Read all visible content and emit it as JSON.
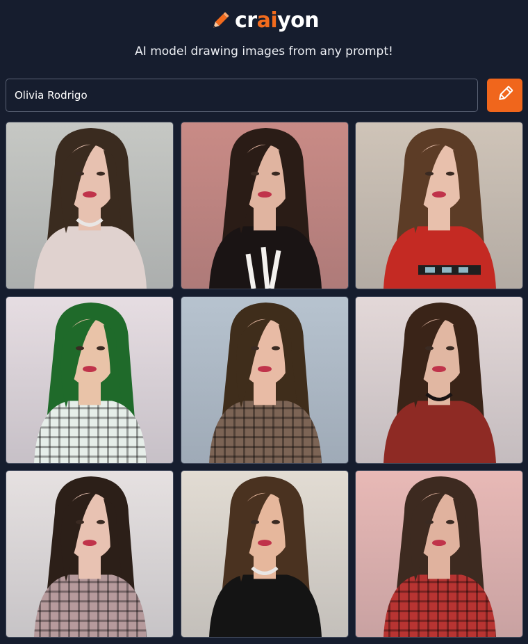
{
  "header": {
    "logo_prefix": "cr",
    "logo_accent": "ai",
    "logo_suffix": "yon",
    "logo_icon": "pencil-icon",
    "tagline": "AI model drawing images from any prompt!"
  },
  "prompt": {
    "value": "Olivia Rodrigo",
    "button_icon": "pencil-icon"
  },
  "colors": {
    "background": "#161d2e",
    "accent": "#f0661c",
    "border": "#5b6375"
  },
  "results": [
    {
      "background": "#c6c8c4",
      "hair": "#3a2b1f",
      "skin": "#e7c1b0",
      "top": "#e0d2cf",
      "accessory": "necklace"
    },
    {
      "background": "#c98b86",
      "hair": "#2a1c16",
      "skin": "#e0b4a0",
      "top": "#1a1414",
      "accessory": "print"
    },
    {
      "background": "#cfc4b8",
      "hair": "#5c3c26",
      "skin": "#e8c0ac",
      "top": "#c42a23",
      "accessory": "belt"
    },
    {
      "background": "#e6dde2",
      "hair": "#1f6a2a",
      "skin": "#e9c3a8",
      "top": "#e6eee9",
      "accessory": "plaid"
    },
    {
      "background": "#b7c3cf",
      "hair": "#3f2d1b",
      "skin": "#e8bba5",
      "top": "#7c6455",
      "accessory": "plaid"
    },
    {
      "background": "#e3d8d8",
      "hair": "#3a2418",
      "skin": "#e1b7a2",
      "top": "#8e2a24",
      "accessory": "choker"
    },
    {
      "background": "#e6e1e1",
      "hair": "#2c1f18",
      "skin": "#e8c2b2",
      "top": "#b69a9c",
      "accessory": "plaid"
    },
    {
      "background": "#e2dcd3",
      "hair": "#4a3220",
      "skin": "#e6b79c",
      "top": "#141414",
      "accessory": "necklace"
    },
    {
      "background": "#e8b9b6",
      "hair": "#3d2a20",
      "skin": "#e0b29e",
      "top": "#b83432",
      "accessory": "plaid"
    }
  ]
}
